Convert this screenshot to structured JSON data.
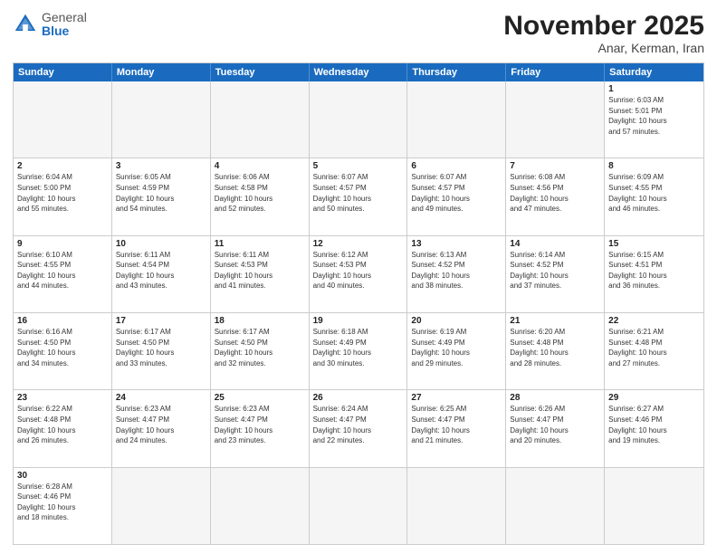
{
  "header": {
    "logo_general": "General",
    "logo_blue": "Blue",
    "month_title": "November 2025",
    "location": "Anar, Kerman, Iran"
  },
  "days_of_week": [
    "Sunday",
    "Monday",
    "Tuesday",
    "Wednesday",
    "Thursday",
    "Friday",
    "Saturday"
  ],
  "weeks": [
    [
      {
        "day": "",
        "info": ""
      },
      {
        "day": "",
        "info": ""
      },
      {
        "day": "",
        "info": ""
      },
      {
        "day": "",
        "info": ""
      },
      {
        "day": "",
        "info": ""
      },
      {
        "day": "",
        "info": ""
      },
      {
        "day": "1",
        "info": "Sunrise: 6:03 AM\nSunset: 5:01 PM\nDaylight: 10 hours\nand 57 minutes."
      }
    ],
    [
      {
        "day": "2",
        "info": "Sunrise: 6:04 AM\nSunset: 5:00 PM\nDaylight: 10 hours\nand 55 minutes."
      },
      {
        "day": "3",
        "info": "Sunrise: 6:05 AM\nSunset: 4:59 PM\nDaylight: 10 hours\nand 54 minutes."
      },
      {
        "day": "4",
        "info": "Sunrise: 6:06 AM\nSunset: 4:58 PM\nDaylight: 10 hours\nand 52 minutes."
      },
      {
        "day": "5",
        "info": "Sunrise: 6:07 AM\nSunset: 4:57 PM\nDaylight: 10 hours\nand 50 minutes."
      },
      {
        "day": "6",
        "info": "Sunrise: 6:07 AM\nSunset: 4:57 PM\nDaylight: 10 hours\nand 49 minutes."
      },
      {
        "day": "7",
        "info": "Sunrise: 6:08 AM\nSunset: 4:56 PM\nDaylight: 10 hours\nand 47 minutes."
      },
      {
        "day": "8",
        "info": "Sunrise: 6:09 AM\nSunset: 4:55 PM\nDaylight: 10 hours\nand 46 minutes."
      }
    ],
    [
      {
        "day": "9",
        "info": "Sunrise: 6:10 AM\nSunset: 4:55 PM\nDaylight: 10 hours\nand 44 minutes."
      },
      {
        "day": "10",
        "info": "Sunrise: 6:11 AM\nSunset: 4:54 PM\nDaylight: 10 hours\nand 43 minutes."
      },
      {
        "day": "11",
        "info": "Sunrise: 6:11 AM\nSunset: 4:53 PM\nDaylight: 10 hours\nand 41 minutes."
      },
      {
        "day": "12",
        "info": "Sunrise: 6:12 AM\nSunset: 4:53 PM\nDaylight: 10 hours\nand 40 minutes."
      },
      {
        "day": "13",
        "info": "Sunrise: 6:13 AM\nSunset: 4:52 PM\nDaylight: 10 hours\nand 38 minutes."
      },
      {
        "day": "14",
        "info": "Sunrise: 6:14 AM\nSunset: 4:52 PM\nDaylight: 10 hours\nand 37 minutes."
      },
      {
        "day": "15",
        "info": "Sunrise: 6:15 AM\nSunset: 4:51 PM\nDaylight: 10 hours\nand 36 minutes."
      }
    ],
    [
      {
        "day": "16",
        "info": "Sunrise: 6:16 AM\nSunset: 4:50 PM\nDaylight: 10 hours\nand 34 minutes."
      },
      {
        "day": "17",
        "info": "Sunrise: 6:17 AM\nSunset: 4:50 PM\nDaylight: 10 hours\nand 33 minutes."
      },
      {
        "day": "18",
        "info": "Sunrise: 6:17 AM\nSunset: 4:50 PM\nDaylight: 10 hours\nand 32 minutes."
      },
      {
        "day": "19",
        "info": "Sunrise: 6:18 AM\nSunset: 4:49 PM\nDaylight: 10 hours\nand 30 minutes."
      },
      {
        "day": "20",
        "info": "Sunrise: 6:19 AM\nSunset: 4:49 PM\nDaylight: 10 hours\nand 29 minutes."
      },
      {
        "day": "21",
        "info": "Sunrise: 6:20 AM\nSunset: 4:48 PM\nDaylight: 10 hours\nand 28 minutes."
      },
      {
        "day": "22",
        "info": "Sunrise: 6:21 AM\nSunset: 4:48 PM\nDaylight: 10 hours\nand 27 minutes."
      }
    ],
    [
      {
        "day": "23",
        "info": "Sunrise: 6:22 AM\nSunset: 4:48 PM\nDaylight: 10 hours\nand 26 minutes."
      },
      {
        "day": "24",
        "info": "Sunrise: 6:23 AM\nSunset: 4:47 PM\nDaylight: 10 hours\nand 24 minutes."
      },
      {
        "day": "25",
        "info": "Sunrise: 6:23 AM\nSunset: 4:47 PM\nDaylight: 10 hours\nand 23 minutes."
      },
      {
        "day": "26",
        "info": "Sunrise: 6:24 AM\nSunset: 4:47 PM\nDaylight: 10 hours\nand 22 minutes."
      },
      {
        "day": "27",
        "info": "Sunrise: 6:25 AM\nSunset: 4:47 PM\nDaylight: 10 hours\nand 21 minutes."
      },
      {
        "day": "28",
        "info": "Sunrise: 6:26 AM\nSunset: 4:47 PM\nDaylight: 10 hours\nand 20 minutes."
      },
      {
        "day": "29",
        "info": "Sunrise: 6:27 AM\nSunset: 4:46 PM\nDaylight: 10 hours\nand 19 minutes."
      }
    ],
    [
      {
        "day": "30",
        "info": "Sunrise: 6:28 AM\nSunset: 4:46 PM\nDaylight: 10 hours\nand 18 minutes."
      },
      {
        "day": "",
        "info": ""
      },
      {
        "day": "",
        "info": ""
      },
      {
        "day": "",
        "info": ""
      },
      {
        "day": "",
        "info": ""
      },
      {
        "day": "",
        "info": ""
      },
      {
        "day": "",
        "info": ""
      }
    ]
  ]
}
